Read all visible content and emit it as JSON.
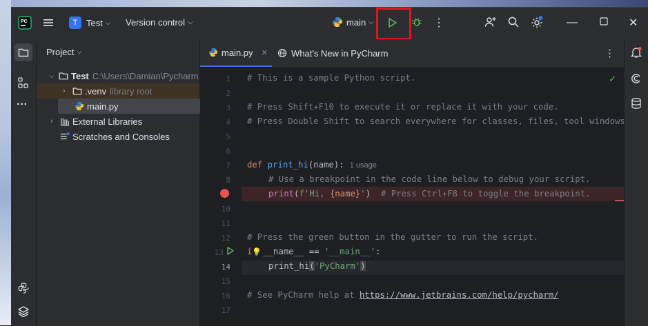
{
  "title_bar": {
    "project_badge": "T",
    "project_name": "Test",
    "vcs_label": "Version control",
    "run_config": "main"
  },
  "project_panel": {
    "header": "Project",
    "tree": [
      {
        "label": "Test",
        "hint": "C:\\Users\\Damian\\Pycharm"
      },
      {
        "label": ".venv",
        "hint": "library root"
      },
      {
        "label": "main.py",
        "hint": ""
      },
      {
        "label": "External Libraries",
        "hint": ""
      },
      {
        "label": "Scratches and Consoles",
        "hint": ""
      }
    ]
  },
  "editor": {
    "tabs": [
      {
        "label": "main.py"
      },
      {
        "label": "What's New in PyCharm"
      }
    ],
    "usage_hint": "1 usage",
    "lines": {
      "l1": "# This is a sample Python script.",
      "l3": "# Press Shift+F10 to execute it or replace it with your code.",
      "l4": "# Press Double Shift to search everywhere for classes, files, tool windows",
      "l7_kw": "def ",
      "l7_fn": "print_hi",
      "l7_rest": "(name):",
      "l8": "# Use a breakpoint in the code line below to debug your script.",
      "l9_fn": "print",
      "l9_open": "(",
      "l9_str1": "f'Hi, ",
      "l9_brace": "{name}",
      "l9_str2": "'",
      "l9_close": ")",
      "l9_cm": "  # Press Ctrl+F8 to toggle the breakpoint.",
      "l12": "# Press the green button in the gutter to run the script.",
      "l13_kw": "i",
      "l13_kw2": "f",
      "l13_dn": "__name__",
      "l13_op": " == ",
      "l13_str": "'__main__'",
      "l13_colon": ":",
      "l14_fn": "print_hi",
      "l14_open": "(",
      "l14_str": "'PyCharm'",
      "l14_close": ")",
      "l16_cm": "# See PyCharm help at ",
      "l16_link": "https://www.jetbrains.com/help/pycharm/"
    },
    "line_numbers": [
      "1",
      "2",
      "3",
      "4",
      "5",
      "6",
      "7",
      "8",
      "",
      "10",
      "11",
      "12",
      "13",
      "14",
      "15",
      "16",
      "17"
    ]
  },
  "colors": {
    "accent_run": "#5fb865",
    "highlight_box": "#e0161b",
    "breakpoint": "#e55353",
    "project_badge": "#3574f0"
  }
}
